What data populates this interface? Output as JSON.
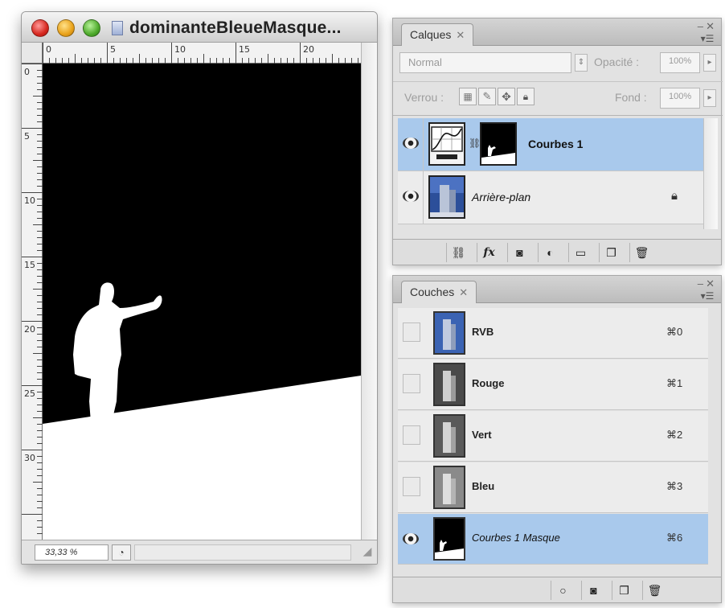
{
  "document": {
    "title": "dominanteBleueMasque...",
    "zoom": "33,33 %",
    "ruler_top_ticks": [
      "0",
      "5",
      "10",
      "15",
      "20"
    ],
    "ruler_left_ticks": [
      "0",
      "5",
      "10",
      "15",
      "20",
      "25",
      "30"
    ]
  },
  "layers_panel": {
    "tab_label": "Calques",
    "tab_close": "✕",
    "blend_mode": "Normal",
    "opacity_label": "Opacité :",
    "opacity_value": "100%",
    "lock_label": "Verrou :",
    "fill_label": "Fond :",
    "fill_value": "100%",
    "layers": [
      {
        "name": "Courbes 1",
        "selected": true,
        "visible": true
      },
      {
        "name": "Arrière-plan",
        "selected": false,
        "visible": true,
        "locked": true
      }
    ],
    "footer_buttons": [
      "link",
      "fx",
      "mask",
      "adjustment",
      "group",
      "new-layer",
      "trash"
    ]
  },
  "channels_panel": {
    "tab_label": "Couches",
    "tab_close": "✕",
    "channels": [
      {
        "name": "RVB",
        "shortcut": "⌘0",
        "visible": false
      },
      {
        "name": "Rouge",
        "shortcut": "⌘1",
        "visible": false
      },
      {
        "name": "Vert",
        "shortcut": "⌘2",
        "visible": false
      },
      {
        "name": "Bleu",
        "shortcut": "⌘3",
        "visible": false
      },
      {
        "name": "Courbes 1 Masque",
        "shortcut": "⌘6",
        "visible": true,
        "selected": true
      }
    ],
    "footer_buttons": [
      "load-selection",
      "save-selection",
      "new-channel",
      "trash"
    ]
  },
  "colors": {
    "selection_blue": "#a9c9ec",
    "panel_bg": "#e2e2e2"
  }
}
